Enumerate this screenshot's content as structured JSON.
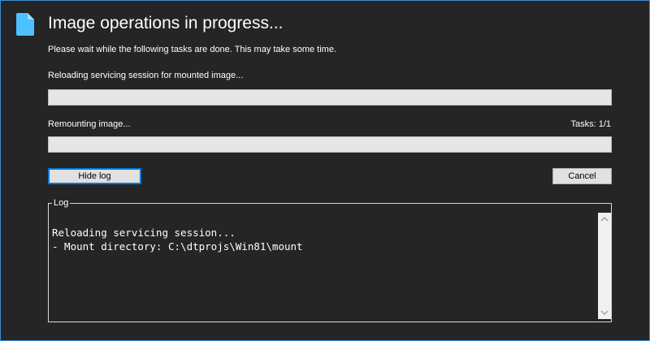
{
  "window": {
    "title": "Image operations in progress...",
    "subtitle": "Please wait while the following tasks are done. This may take some time."
  },
  "tasks": {
    "current_label": "Reloading servicing session for mounted image...",
    "current_progress": 0,
    "overall_label": "Remounting image...",
    "overall_progress": 0,
    "counter": "Tasks: 1/1"
  },
  "buttons": {
    "hide_log": "Hide log",
    "cancel": "Cancel"
  },
  "log": {
    "legend": "Log",
    "content": "Reloading servicing session...\n- Mount directory: C:\\dtprojs\\Win81\\mount"
  },
  "icons": {
    "app": "document-icon",
    "scroll_up": "chevron-up-icon",
    "scroll_down": "chevron-down-icon"
  },
  "colors": {
    "accent": "#3b8fd8",
    "icon": "#4cc2ff",
    "background": "#252525"
  }
}
